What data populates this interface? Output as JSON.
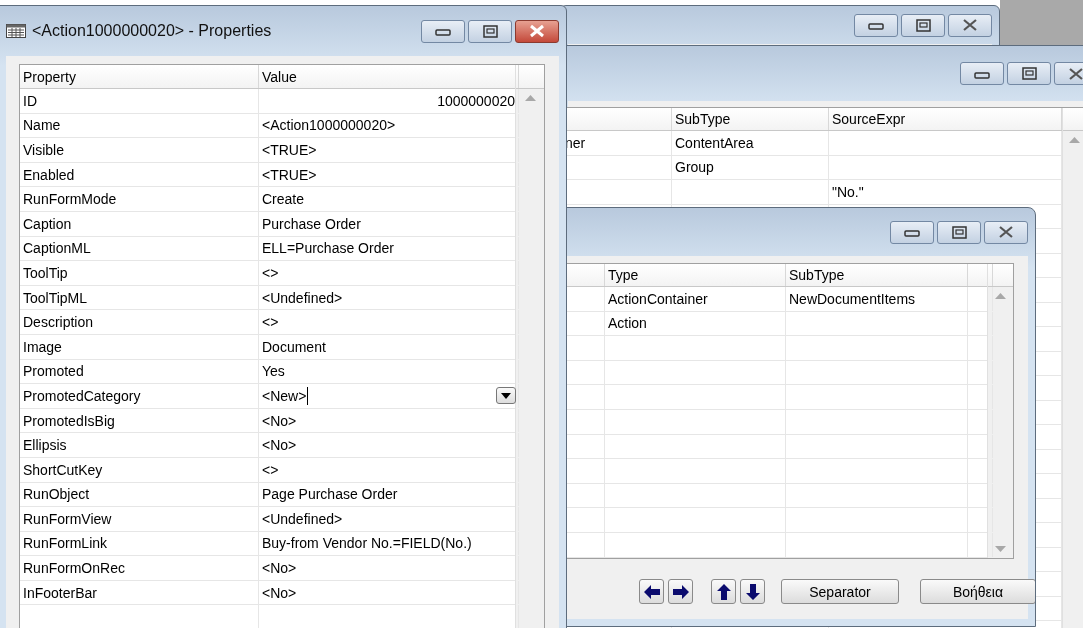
{
  "properties_window": {
    "title": "<Action1000000020> - Properties",
    "columns": [
      "Property",
      "Value"
    ],
    "rows": [
      {
        "property": "ID",
        "value": "1000000020",
        "kind": "number"
      },
      {
        "property": "Name",
        "value": "<Action1000000020>",
        "kind": "text"
      },
      {
        "property": "Visible",
        "value": "<TRUE>",
        "kind": "text"
      },
      {
        "property": "Enabled",
        "value": "<TRUE>",
        "kind": "text"
      },
      {
        "property": "RunFormMode",
        "value": "Create",
        "kind": "text"
      },
      {
        "property": "Caption",
        "value": "Purchase Order",
        "kind": "text"
      },
      {
        "property": "CaptionML",
        "value": "ELL=Purchase Order",
        "kind": "text"
      },
      {
        "property": "ToolTip",
        "value": "<>",
        "kind": "text"
      },
      {
        "property": "ToolTipML",
        "value": "<Undefined>",
        "kind": "text"
      },
      {
        "property": "Description",
        "value": "<>",
        "kind": "text"
      },
      {
        "property": "Image",
        "value": "Document",
        "kind": "text"
      },
      {
        "property": "Promoted",
        "value": "Yes",
        "kind": "text"
      },
      {
        "property": "PromotedCategory",
        "value": "<New>",
        "kind": "dropdown"
      },
      {
        "property": "PromotedIsBig",
        "value": "<No>",
        "kind": "text"
      },
      {
        "property": "Ellipsis",
        "value": "<No>",
        "kind": "text"
      },
      {
        "property": "ShortCutKey",
        "value": "<>",
        "kind": "text"
      },
      {
        "property": "RunObject",
        "value": "Page Purchase Order",
        "kind": "text"
      },
      {
        "property": "RunFormView",
        "value": "<Undefined>",
        "kind": "text"
      },
      {
        "property": "RunFormLink",
        "value": "Buy-from Vendor No.=FIELD(No.)",
        "kind": "text"
      },
      {
        "property": "RunFormOnRec",
        "value": "<No>",
        "kind": "text"
      },
      {
        "property": "InFooterBar",
        "value": "<No>",
        "kind": "text"
      }
    ]
  },
  "page_designer_window": {
    "columns": [
      "SubType",
      "SourceExpr"
    ],
    "rows": [
      {
        "column_1": "ner",
        "subtype": "ContentArea"
      },
      {
        "subtype": "Group"
      },
      {
        "source_expr": "\"No.\""
      }
    ]
  },
  "actions_window": {
    "columns": [
      "Type",
      "SubType"
    ],
    "rows": [
      {
        "type": "ActionContainer",
        "subtype": "NewDocumentItems"
      },
      {
        "type": "Action"
      }
    ],
    "buttons": [
      "Separator",
      "Βοήθεια"
    ]
  }
}
